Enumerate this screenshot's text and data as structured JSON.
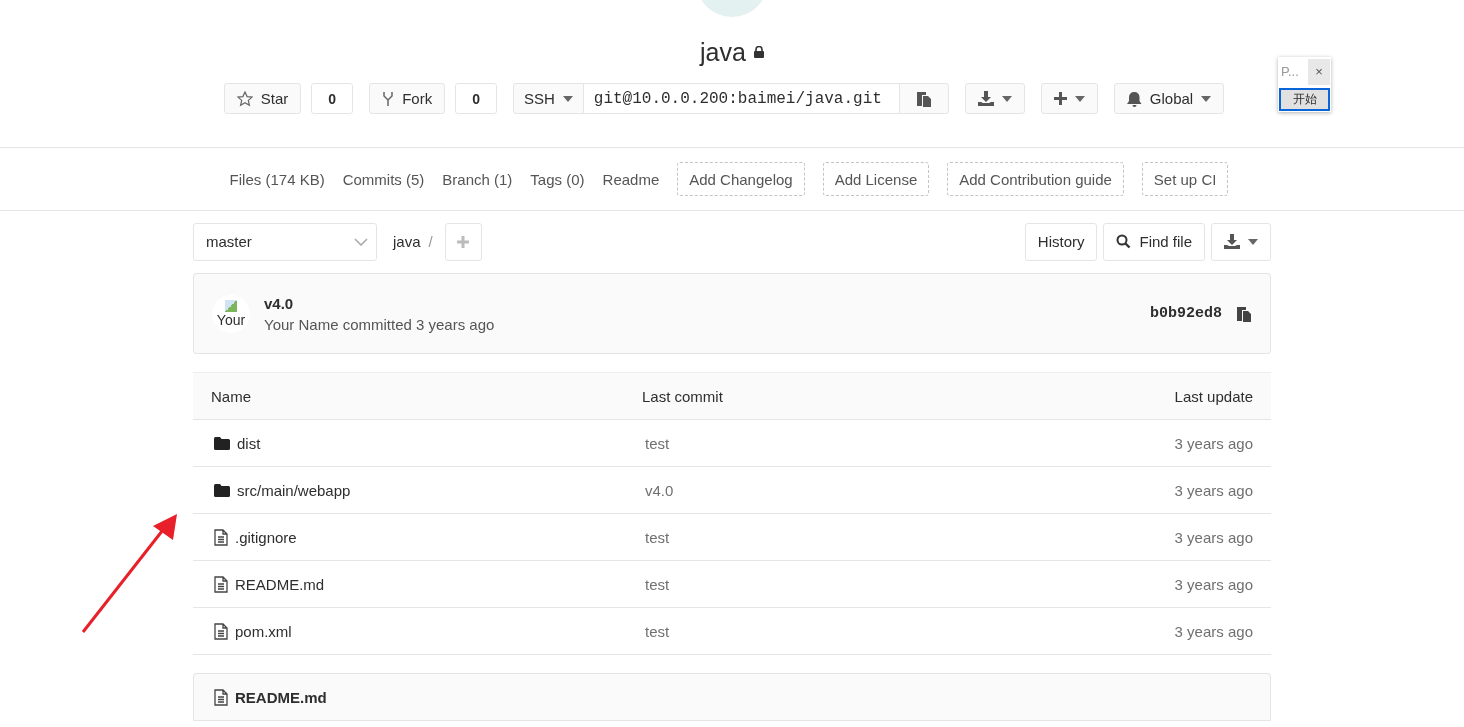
{
  "project": {
    "name": "java",
    "private": true
  },
  "star": {
    "label": "Star",
    "count": "0"
  },
  "fork": {
    "label": "Fork",
    "count": "0"
  },
  "clone": {
    "protocol": "SSH",
    "url": "git@10.0.0.200:baimei/java.git"
  },
  "notification": {
    "label": "Global"
  },
  "popup": {
    "title": "P...",
    "close": "×",
    "button": "开始"
  },
  "stats": [
    {
      "kind": "link",
      "label": "Files (174 KB)"
    },
    {
      "kind": "link",
      "label": "Commits (5)"
    },
    {
      "kind": "link",
      "label": "Branch (1)"
    },
    {
      "kind": "link",
      "label": "Tags (0)"
    },
    {
      "kind": "link",
      "label": "Readme"
    },
    {
      "kind": "dashed",
      "label": "Add Changelog"
    },
    {
      "kind": "dashed",
      "label": "Add License"
    },
    {
      "kind": "dashed",
      "label": "Add Contribution guide"
    },
    {
      "kind": "dashed",
      "label": "Set up CI"
    }
  ],
  "tree": {
    "branch": "master",
    "path": "java",
    "separator": "/",
    "history": "History",
    "find_file": "Find file"
  },
  "commit": {
    "avatar_alt": "Your",
    "title": "v4.0",
    "author_line": "Your Name committed 3 years ago",
    "sha": "b0b92ed8"
  },
  "table": {
    "columns": [
      "Name",
      "Last commit",
      "Last update"
    ],
    "rows": [
      {
        "kind": "folder",
        "name": "dist",
        "commit": "test",
        "updated": "3 years ago"
      },
      {
        "kind": "folder",
        "name": "src/main/webapp",
        "commit": "v4.0",
        "updated": "3 years ago"
      },
      {
        "kind": "file",
        "name": ".gitignore",
        "commit": "test",
        "updated": "3 years ago"
      },
      {
        "kind": "file",
        "name": "README.md",
        "commit": "test",
        "updated": "3 years ago"
      },
      {
        "kind": "file",
        "name": "pom.xml",
        "commit": "test",
        "updated": "3 years ago"
      }
    ]
  },
  "readme": {
    "title": "README.md"
  }
}
